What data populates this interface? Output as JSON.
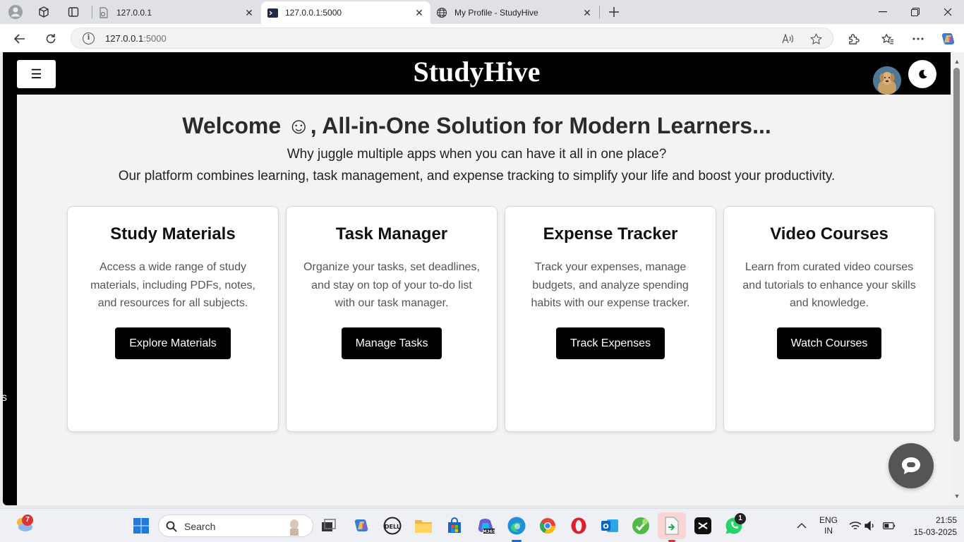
{
  "browser": {
    "tabs": [
      {
        "title": "127.0.0.1",
        "active": false
      },
      {
        "title": "127.0.0.1:5000",
        "active": true
      },
      {
        "title": "My Profile - StudyHive",
        "active": false
      }
    ],
    "address": {
      "host": "127.0.0.1",
      "port": ":5000"
    }
  },
  "header": {
    "menu_icon": "☰",
    "brand": "StudyHive"
  },
  "sidebar_peek": "s",
  "hero": {
    "heading": "Welcome ☺, All-in-One Solution for Modern Learners...",
    "line1": "Why juggle multiple apps when you can have it all in one place?",
    "line2": "Our platform combines learning, task management, and expense tracking to simplify your life and boost your productivity."
  },
  "cards": [
    {
      "title": "Study Materials",
      "desc": "Access a wide range of study materials, including PDFs, notes, and resources for all subjects.",
      "button": "Explore Materials"
    },
    {
      "title": "Task Manager",
      "desc": "Organize your tasks, set deadlines, and stay on top of your to-do list with our task manager.",
      "button": "Manage Tasks"
    },
    {
      "title": "Expense Tracker",
      "desc": "Track your expenses, manage budgets, and analyze spending habits with our expense tracker.",
      "button": "Track Expenses"
    },
    {
      "title": "Video Courses",
      "desc": "Learn from curated video courses and tutorials to enhance your skills and knowledge.",
      "button": "Watch Courses"
    }
  ],
  "taskbar": {
    "weather_badge": "7",
    "search_label": "Search",
    "whatsapp_badge": "1",
    "lang_top": "ENG",
    "lang_bottom": "IN",
    "time": "21:55",
    "date": "15-03-2025"
  },
  "colors": {
    "header_bg": "#000000",
    "page_bg": "#f3f3f3",
    "card_bg": "#ffffff",
    "button_bg": "#000000",
    "chat_fab": "#555555"
  }
}
